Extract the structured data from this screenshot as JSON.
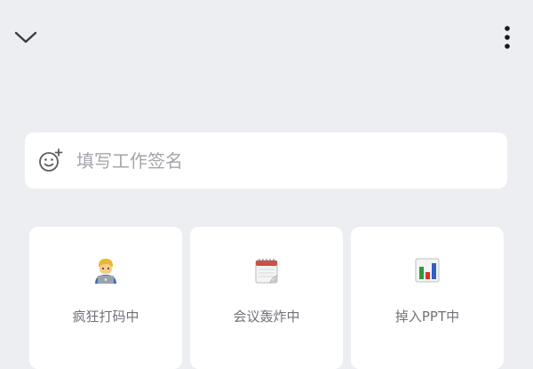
{
  "header": {
    "collapse_icon": "chevron-down-icon",
    "more_icon": "more-vertical-icon"
  },
  "signature": {
    "placeholder": "填写工作签名",
    "value": "",
    "emoji_icon": "add-emoji-icon"
  },
  "status_options": [
    {
      "label": "疯狂打码中",
      "icon": "coder-emoji-icon"
    },
    {
      "label": "会议轰炸中",
      "icon": "calendar-emoji-icon"
    },
    {
      "label": "掉入PPT中",
      "icon": "bar-chart-emoji-icon"
    }
  ],
  "colors": {
    "background": "#edeef2",
    "card": "#ffffff",
    "placeholder_text": "#a3a5ab",
    "label_text": "#6f7278"
  }
}
